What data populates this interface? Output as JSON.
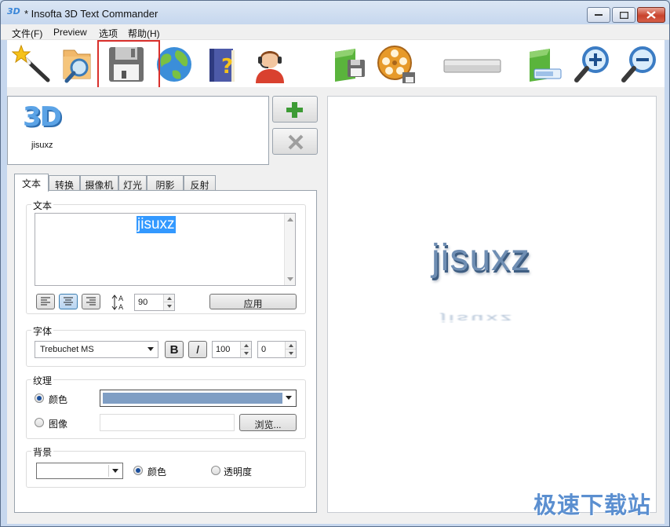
{
  "window": {
    "title": "* Insofta 3D Text Commander",
    "app_icon_label": "3D"
  },
  "menu": {
    "items": [
      "文件(F)",
      "Preview",
      "选项",
      "帮助(H)"
    ]
  },
  "toolbar": {
    "icons": [
      "wizard-icon",
      "open-folder-icon",
      "save-icon",
      "globe-icon",
      "help-book-icon",
      "support-icon",
      "save-image-icon",
      "save-animation-icon",
      "slider-icon",
      "export-icon",
      "zoom-in-icon",
      "zoom-out-icon"
    ],
    "highlight_color": "#d9302c"
  },
  "preview_list": {
    "item_label": "jisuxz",
    "item_badge": "3D"
  },
  "tabs": [
    "文本",
    "转换",
    "摄像机",
    "灯光",
    "阴影",
    "反射"
  ],
  "text_group": {
    "label": "文本",
    "content": "jisuxz",
    "line_spacing": "90",
    "apply_label": "应用"
  },
  "font_group": {
    "label": "字体",
    "font_name": "Trebuchet MS",
    "bold_label": "B",
    "italic_label": "I",
    "size": "100",
    "extra": "0"
  },
  "texture_group": {
    "label": "纹理",
    "color_option": "颜色",
    "image_option": "图像",
    "browse_label": "浏览...",
    "color_value": "#7f9ec4"
  },
  "background_group": {
    "label": "背景",
    "color_option": "颜色",
    "transparency_option": "透明度"
  },
  "preview": {
    "text": "jisuxz",
    "reflection": "jisuxz",
    "text_color": "#6f8eb3"
  },
  "watermark": "极速下载站"
}
